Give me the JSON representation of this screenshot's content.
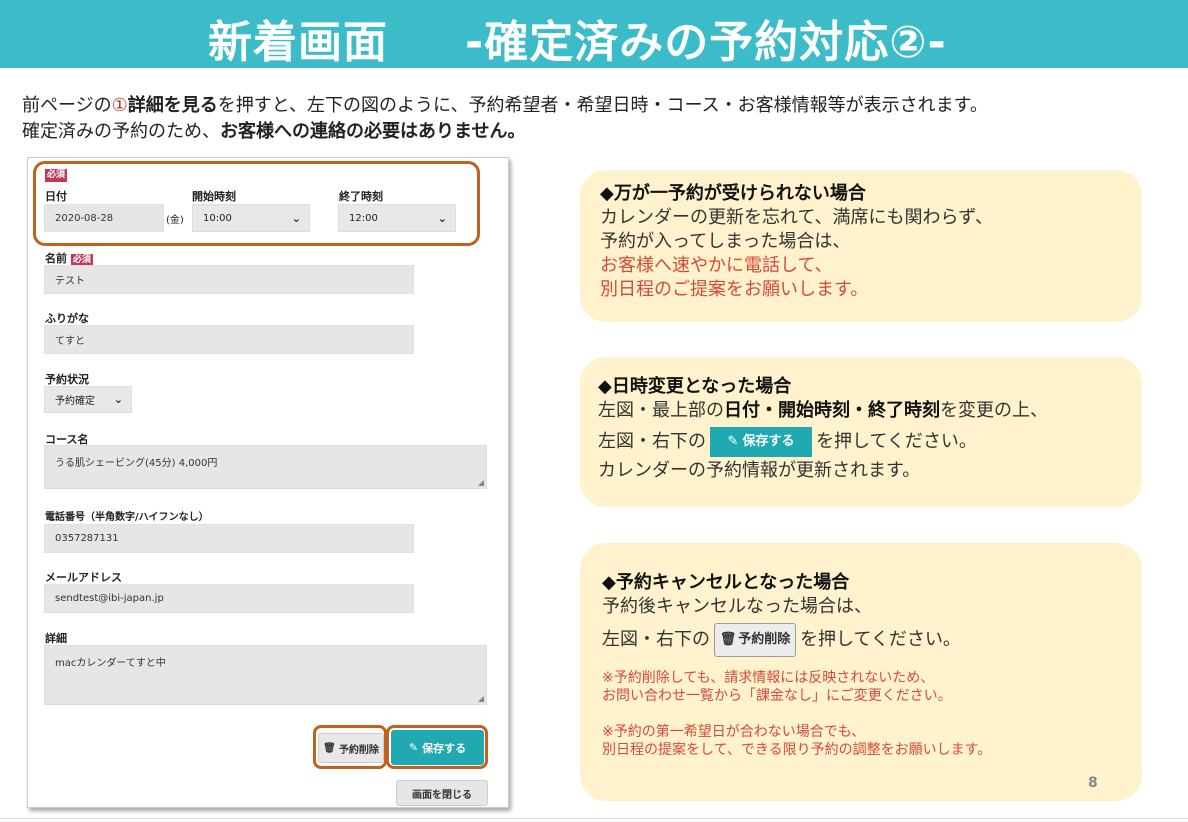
{
  "header": {
    "title": "新着画面",
    "subtitle": "-確定済みの予約対応②-",
    "bg_color": "#3bbcc8"
  },
  "intro": {
    "line1_pre": "前ページの",
    "line1_num": "①",
    "line1_bold": "詳細を見る",
    "line1_post": "を押すと、左下の図のように、予約希望者・希望日時・コース・お客様情報等が表示されます。",
    "line2_pre": "確定済みの予約のため、",
    "line2_bold": "お客様への連絡の必要はありません。"
  },
  "form": {
    "required_badge": "必須",
    "date_label": "日付",
    "date_value": "2020-08-28",
    "weekday": "(金)",
    "start_label": "開始時刻",
    "start_value": "10:00",
    "end_label": "終了時刻",
    "end_value": "12:00",
    "name_label": "名前",
    "name_value": "テスト",
    "furigana_label": "ふりがな",
    "furigana_value": "てすと",
    "status_label": "予約状況",
    "status_value": "予約確定",
    "course_label": "コース名",
    "course_value": "うる肌シェービング(45分) 4,000円",
    "phone_label": "電話番号（半角数字/ハイフンなし）",
    "phone_value": "0357287131",
    "email_label": "メールアドレス",
    "email_value": "sendtest@ibi-japan.jp",
    "detail_label": "詳細",
    "detail_value": "macカレンダーてすと中",
    "delete_button": "予約削除",
    "save_button": "保存する",
    "close_button": "画面を閉じる",
    "accent_color": "#20a9b0",
    "highlight_color": "#c0621e"
  },
  "callouts": {
    "c1": {
      "title": "◆万が一予約が受けられない場合",
      "line1": "カレンダーの更新を忘れて、満席にも関わらず、",
      "line2": "予約が入ってしまった場合は、",
      "line3": "お客様へ速やかに電話して、",
      "line4": "別日程のご提案をお願いします。"
    },
    "c2": {
      "title": "◆日時変更となった場合",
      "line1_pre": "左図・最上部の",
      "line1_bold": "日付・開始時刻・終了時刻",
      "line1_post": "を変更の上、",
      "line2_pre": "左図・右下の",
      "line2_button": "保存する",
      "line2_post": "を押してください。",
      "line3": "カレンダーの予約情報が更新されます。"
    },
    "c3": {
      "title": "◆予約キャンセルとなった場合",
      "line1": "予約後キャンセルなった場合は、",
      "line2_pre": "左図・右下の",
      "line2_button": "予約削除",
      "line2_post": "を押してください。",
      "note1a": "※予約削除しても、請求情報には反映されないため、",
      "note1b": "お問い合わせ一覧から「課金なし」にご変更ください。",
      "note2a": "※予約の第一希望日が合わない場合でも、",
      "note2b": "別日程の提案をして、できる限り予約の調整をお願いします。"
    },
    "bg_color": "#fff2cc"
  },
  "page_number": "8"
}
